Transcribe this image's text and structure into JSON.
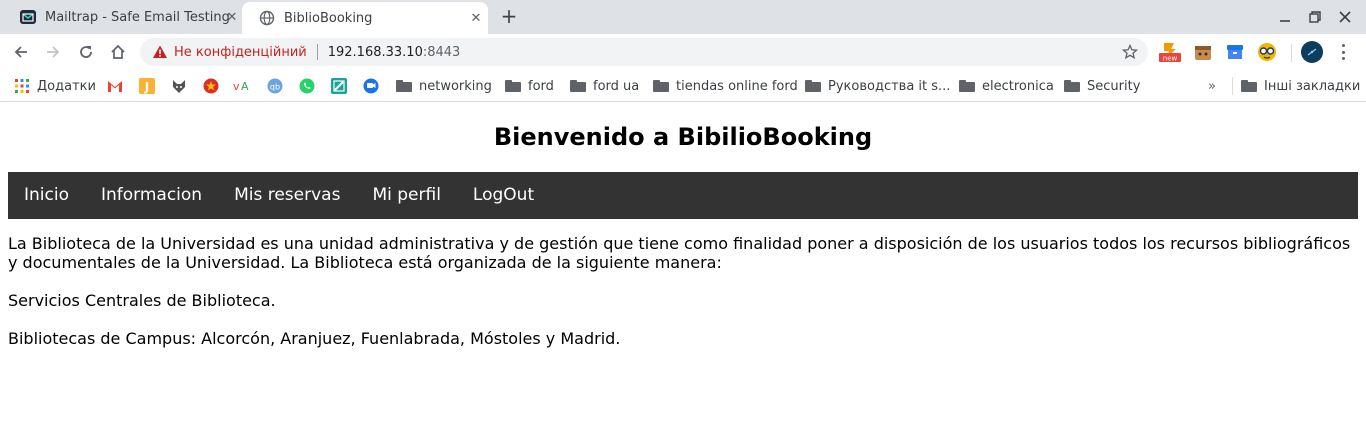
{
  "tabs": [
    {
      "title": "Mailtrap - Safe Email Testing",
      "icon": "mailtrap-icon",
      "active": false
    },
    {
      "title": "BiblioBooking",
      "icon": "globe-icon",
      "active": true
    }
  ],
  "toolbar": {
    "security_label": "Не конфіденційний",
    "url_host": "192.168.33.10",
    "url_port": ":8443",
    "extensions": [
      "new-badge-extension-icon",
      "gift-extension-icon",
      "blue-box-extension-icon",
      "glasses-extension-icon"
    ]
  },
  "bookmarks": {
    "apps_label": "Додатки",
    "icons": [
      "gmail-icon",
      "j-icon",
      "fox-icon",
      "star-badge-icon",
      "va-icon",
      "qb-icon",
      "whatsapp-icon",
      "green-app-icon",
      "chat-icon"
    ],
    "folders": [
      "networking",
      "ford",
      "ford ua",
      "tiendas online ford",
      "Руководства it s...",
      "electronica",
      "Security"
    ],
    "overflow": "»",
    "other_bookmarks": "Інші закладки"
  },
  "page": {
    "title": "Bienvenido a BibilioBooking",
    "nav": [
      "Inicio",
      "Informacion",
      "Mis reservas",
      "Mi perfil",
      "LogOut"
    ],
    "paragraphs": [
      "La Biblioteca de la Universidad es una unidad administrativa y de gestión que tiene como finalidad poner a disposición de los usuarios todos los recursos bibliográficos y documentales de la Universidad. La Biblioteca está organizada de la siguiente manera:",
      "Servicios Centrales de Biblioteca.",
      "Bibliotecas de Campus: Alcorcón, Aranjuez, Fuenlabrada, Móstoles y Madrid."
    ]
  },
  "colors": {
    "navbar_bg": "#333333",
    "security_warning": "#c5221f",
    "tabstrip_bg": "#dee1e6"
  }
}
